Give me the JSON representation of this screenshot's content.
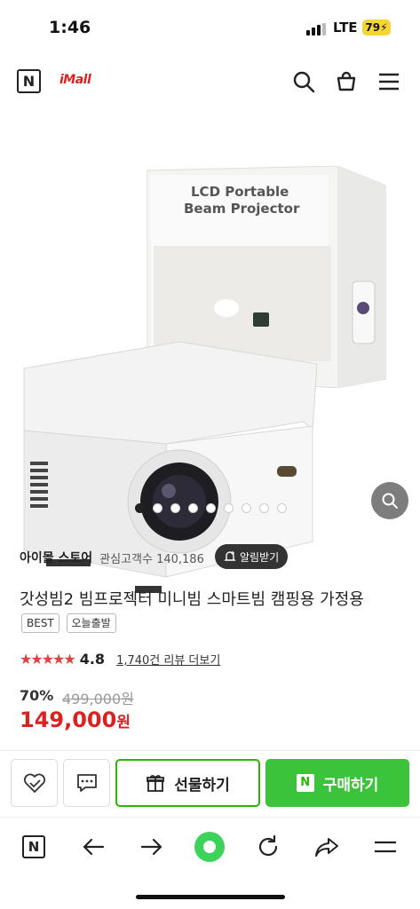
{
  "status_bar": {
    "time": "1:46",
    "network": "LTE",
    "battery": "79"
  },
  "header": {
    "brand_logo": "N",
    "store_logo": "iMall",
    "icons": [
      "search-icon",
      "cart-icon",
      "menu-icon"
    ]
  },
  "gallery": {
    "image_count": 9,
    "active_index": 0,
    "zoom_icon": "search-icon",
    "image_alt": "LCD Portable Beam Projector"
  },
  "product_box": {
    "title_line1": "LCD Portable",
    "title_line2": "Beam Projector"
  },
  "store": {
    "name": "아이몰 스토어",
    "followers_label": "관심고객수 140,186",
    "alarm_button": "알림받기"
  },
  "product": {
    "title": "갓성빔2 빔프로젝터 미니빔 스마트빔 캠핑용 가정용",
    "tags": [
      "BEST",
      "오늘출발"
    ],
    "rating_stars": "★★★★★",
    "rating": "4.8",
    "reviews": "1,740건 리뷰 더보기",
    "discount": "70%",
    "original_price": "499,000원",
    "price": "149,000",
    "price_unit": "원"
  },
  "actions": {
    "gift_button": "선물하기",
    "buy_button": "구매하기",
    "buy_badge": "N"
  },
  "browser_bar": {
    "icons": [
      "naver-home-icon",
      "back-arrow-icon",
      "forward-arrow-icon",
      "green-dot-icon",
      "refresh-icon",
      "share-icon",
      "menu-icon"
    ]
  },
  "colors": {
    "accent_green": "#3cc33c",
    "price_red": "#d92323",
    "star_red": "#d94343"
  }
}
